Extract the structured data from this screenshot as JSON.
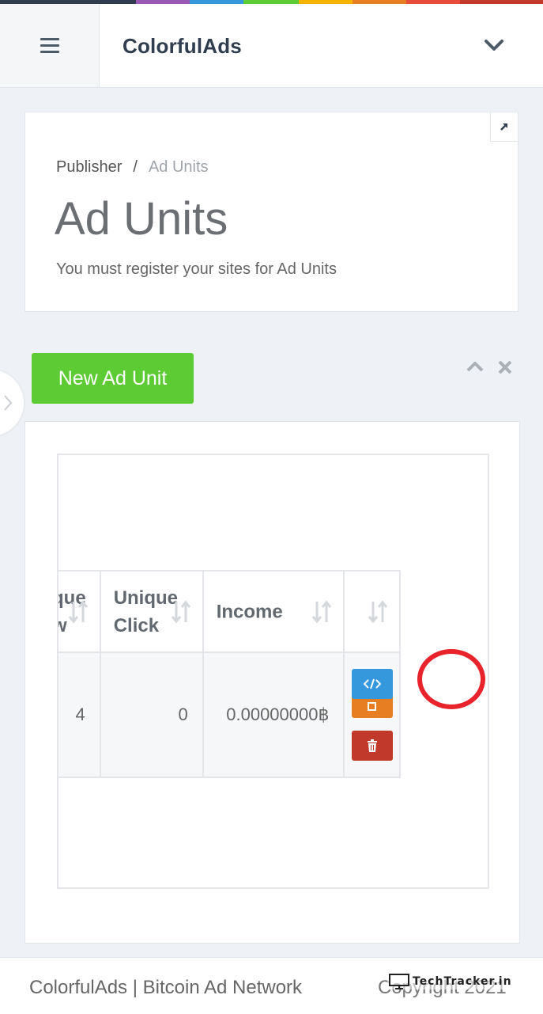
{
  "colors": {
    "stripe": [
      "#2f3d4e",
      "#9b59b6",
      "#3598dc",
      "#5dcb34",
      "#f4b400",
      "#e87e22",
      "#e74c3c",
      "#c0392b"
    ],
    "new_button": "#5dcb34",
    "code_button": "#3598dc",
    "edit_button": "#e87e22",
    "delete_button": "#c0392b",
    "highlight_ring": "#e8232b"
  },
  "header": {
    "brand": "ColorfulAds",
    "menu_icon": "hamburger-icon",
    "dropdown_icon": "chevron-down-icon"
  },
  "page": {
    "breadcrumb": {
      "parent": "Publisher",
      "separator": "/",
      "current": "Ad Units"
    },
    "title": "Ad Units",
    "subtitle": "You must register your sites for Ad Units",
    "expand_icon": "arrow-up-right-icon"
  },
  "toolbar": {
    "new_button_label": "New Ad Unit",
    "collapse_icon": "chevron-up-icon",
    "close_icon": "close-icon"
  },
  "table": {
    "columns": [
      {
        "line1": "que",
        "line2": "w"
      },
      {
        "line1": "Unique",
        "line2": "Click"
      },
      {
        "line1": "",
        "line2": "Income"
      },
      {
        "line1": "",
        "line2": ""
      }
    ],
    "rows": [
      {
        "unique_view": "4",
        "unique_click": "0",
        "income": "0.00000000฿",
        "actions": [
          "code-icon",
          "edit-icon",
          "trash-icon"
        ]
      }
    ]
  },
  "footer": {
    "text": "ColorfulAds | Bitcoin Ad Network",
    "copyright": "Copyright 2021",
    "watermark": "TechTracker.in"
  }
}
